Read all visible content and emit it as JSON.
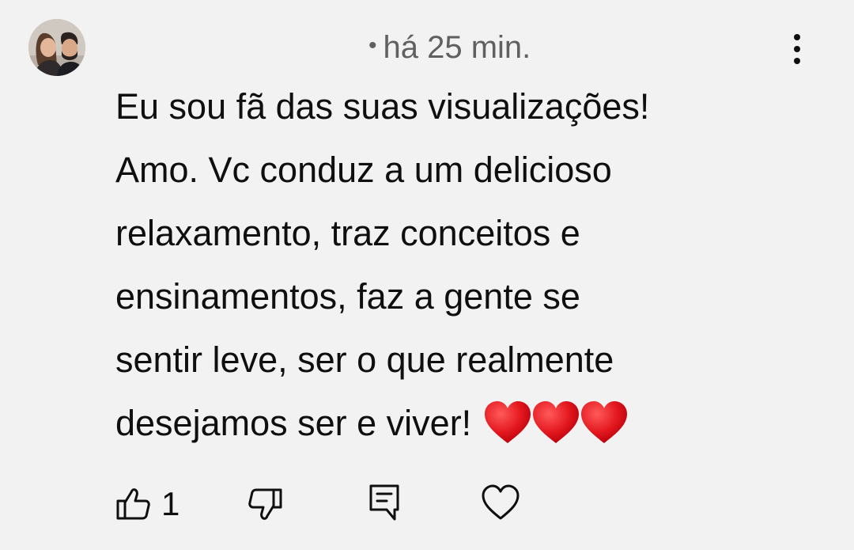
{
  "comment": {
    "time_dot": "•",
    "time": "há 25 min.",
    "lines": [
      "Eu sou fã das suas visualizações!",
      "Amo. Vc conduz a um delicioso",
      "relaxamento, traz conceitos e",
      "ensinamentos, faz a gente se",
      "sentir leve, ser o que realmente",
      "desejamos ser e viver!"
    ],
    "emoji": "❤❤❤",
    "like_count": "1"
  },
  "icons": {
    "avatar": "avatar-photo",
    "menu": "more-vertical-icon",
    "like": "thumbs-up-icon",
    "dislike": "thumbs-down-icon",
    "reply": "reply-comment-icon",
    "heart": "heart-outline-icon"
  },
  "colors": {
    "background": "#f2f2f2",
    "text": "#0f0f0f",
    "secondary_text": "#606060",
    "heart_red": "#e3171e"
  }
}
